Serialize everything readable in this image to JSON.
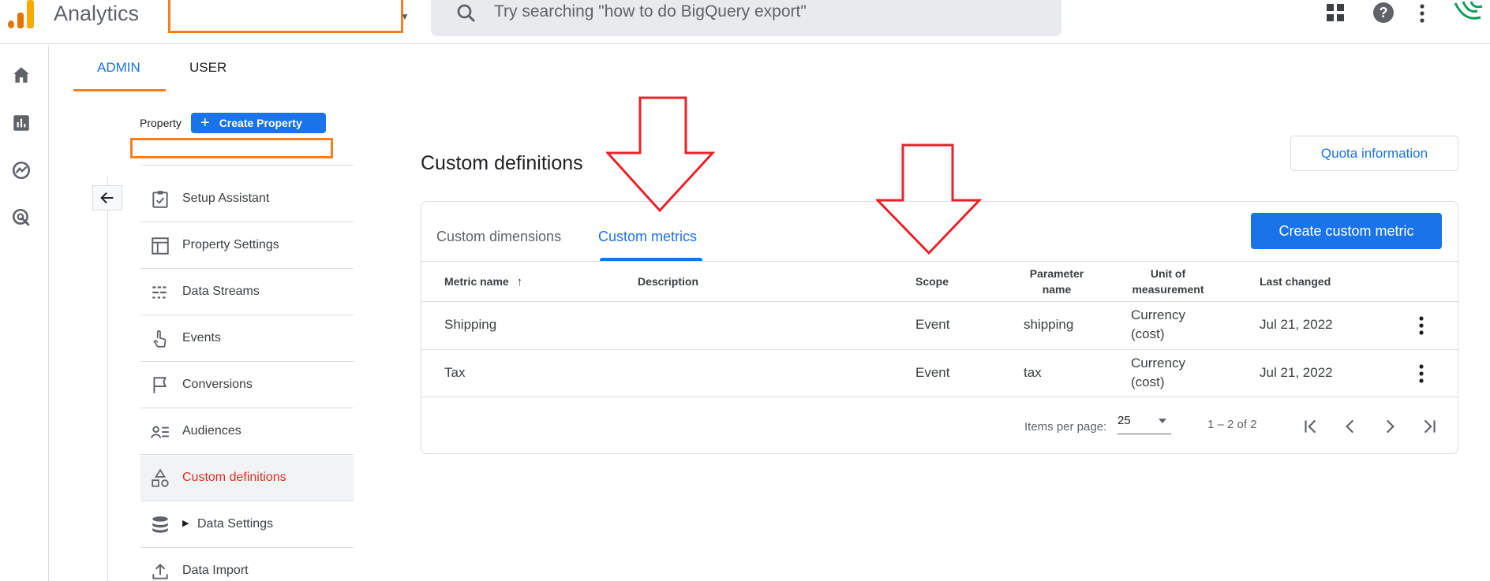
{
  "header": {
    "app_title": "Analytics",
    "search_placeholder": "Try searching \"how to do BigQuery export\""
  },
  "tabs": [
    {
      "label": "ADMIN",
      "active": true
    },
    {
      "label": "USER",
      "active": false
    }
  ],
  "property": {
    "label": "Property",
    "create_button": "Create Property"
  },
  "nav": {
    "items": [
      {
        "label": "Setup Assistant",
        "icon": "checklist-icon"
      },
      {
        "label": "Property Settings",
        "icon": "layout-icon"
      },
      {
        "label": "Data Streams",
        "icon": "streams-icon"
      },
      {
        "label": "Events",
        "icon": "touch-icon"
      },
      {
        "label": "Conversions",
        "icon": "flag-icon"
      },
      {
        "label": "Audiences",
        "icon": "audience-icon"
      },
      {
        "label": "Custom definitions",
        "icon": "shapes-icon",
        "active": true
      },
      {
        "label": "Data Settings",
        "icon": "database-icon",
        "expandable": true
      },
      {
        "label": "Data Import",
        "icon": "upload-icon"
      }
    ]
  },
  "main": {
    "title": "Custom definitions",
    "quota_button": "Quota information",
    "tabs": [
      {
        "label": "Custom dimensions",
        "active": false
      },
      {
        "label": "Custom metrics",
        "active": true
      }
    ],
    "create_button": "Create custom metric",
    "columns": {
      "metric_name": "Metric name",
      "description": "Description",
      "scope": "Scope",
      "parameter_name_1": "Parameter",
      "parameter_name_2": "name",
      "unit_1": "Unit of",
      "unit_2": "measurement",
      "last_changed": "Last changed"
    },
    "rows": [
      {
        "name": "Shipping",
        "description": "",
        "scope": "Event",
        "parameter": "shipping",
        "unit_1": "Currency",
        "unit_2": "(cost)",
        "last_changed": "Jul 21, 2022"
      },
      {
        "name": "Tax",
        "description": "",
        "scope": "Event",
        "parameter": "tax",
        "unit_1": "Currency",
        "unit_2": "(cost)",
        "last_changed": "Jul 21, 2022"
      }
    ],
    "pagination": {
      "items_per_page_label": "Items per page:",
      "items_per_page": "25",
      "range": "1 – 2 of 2"
    }
  },
  "colors": {
    "accent": "#1a73e8",
    "highlight_orange": "#f48024",
    "annotation_red": "#e8222a",
    "active_nav_text": "#d93025"
  }
}
